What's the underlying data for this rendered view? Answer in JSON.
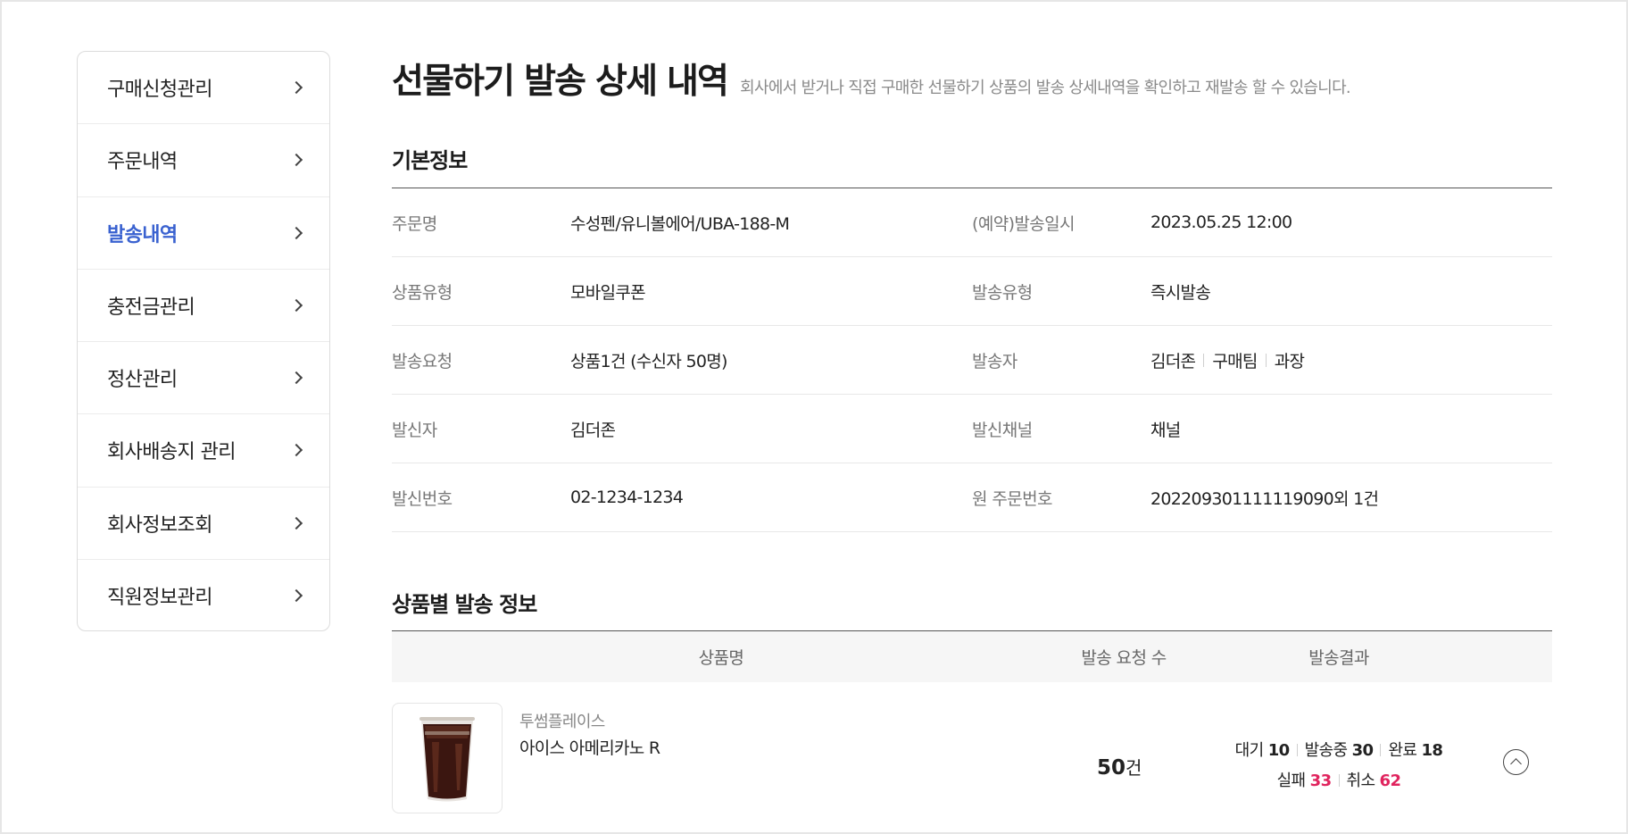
{
  "sidebar": {
    "items": [
      {
        "label": "구매신청관리"
      },
      {
        "label": "주문내역"
      },
      {
        "label": "발송내역",
        "active": true
      },
      {
        "label": "충전금관리"
      },
      {
        "label": "정산관리"
      },
      {
        "label": "회사배송지 관리"
      },
      {
        "label": "회사정보조회"
      },
      {
        "label": "직원정보관리"
      }
    ]
  },
  "header": {
    "title": "선물하기 발송 상세 내역",
    "description": "회사에서 받거나 직접 구매한 선물하기 상품의 발송 상세내역을 확인하고 재발송 할 수 있습니다."
  },
  "basic_info": {
    "title": "기본정보",
    "rows": [
      {
        "k1": "주문명",
        "v1": "수성펜/유니볼에어/UBA-188-M",
        "k2": "(예약)발송일시",
        "v2": "2023.05.25 12:00"
      },
      {
        "k1": "상품유형",
        "v1": "모바일쿠폰",
        "k2": "발송유형",
        "v2": "즉시발송"
      },
      {
        "k1": "발송요청",
        "v1": "상품1건 (수신자 50명)",
        "k2": "발송자",
        "v2_parts": [
          "김더존",
          "구매팀",
          "과장"
        ]
      },
      {
        "k1": "발신자",
        "v1": "김더존",
        "k2": "발신채널",
        "v2": "채널"
      },
      {
        "k1": "발신번호",
        "v1": "02-1234-1234",
        "k2": "원 주문번호",
        "v2": "202209301111119090외 1건"
      }
    ]
  },
  "product_info": {
    "title": "상품별 발송 정보",
    "headers": {
      "name": "상품명",
      "count": "발송 요청 수",
      "result": "발송결과"
    },
    "item": {
      "brand": "투썸플레이스",
      "name": "아이스 아메리카노 R",
      "count_value": "50",
      "count_unit": "건",
      "results": {
        "wait_label": "대기",
        "wait_value": "10",
        "sending_label": "발송중",
        "sending_value": "30",
        "done_label": "완료",
        "done_value": "18",
        "fail_label": "실패",
        "fail_value": "33",
        "cancel_label": "취소",
        "cancel_value": "62"
      },
      "image_icon": "iced-americano-cup-image",
      "toggle_icon": "chevron-up-circle-icon"
    }
  },
  "colors": {
    "accent": "#3a62d0",
    "danger": "#e0245e"
  }
}
